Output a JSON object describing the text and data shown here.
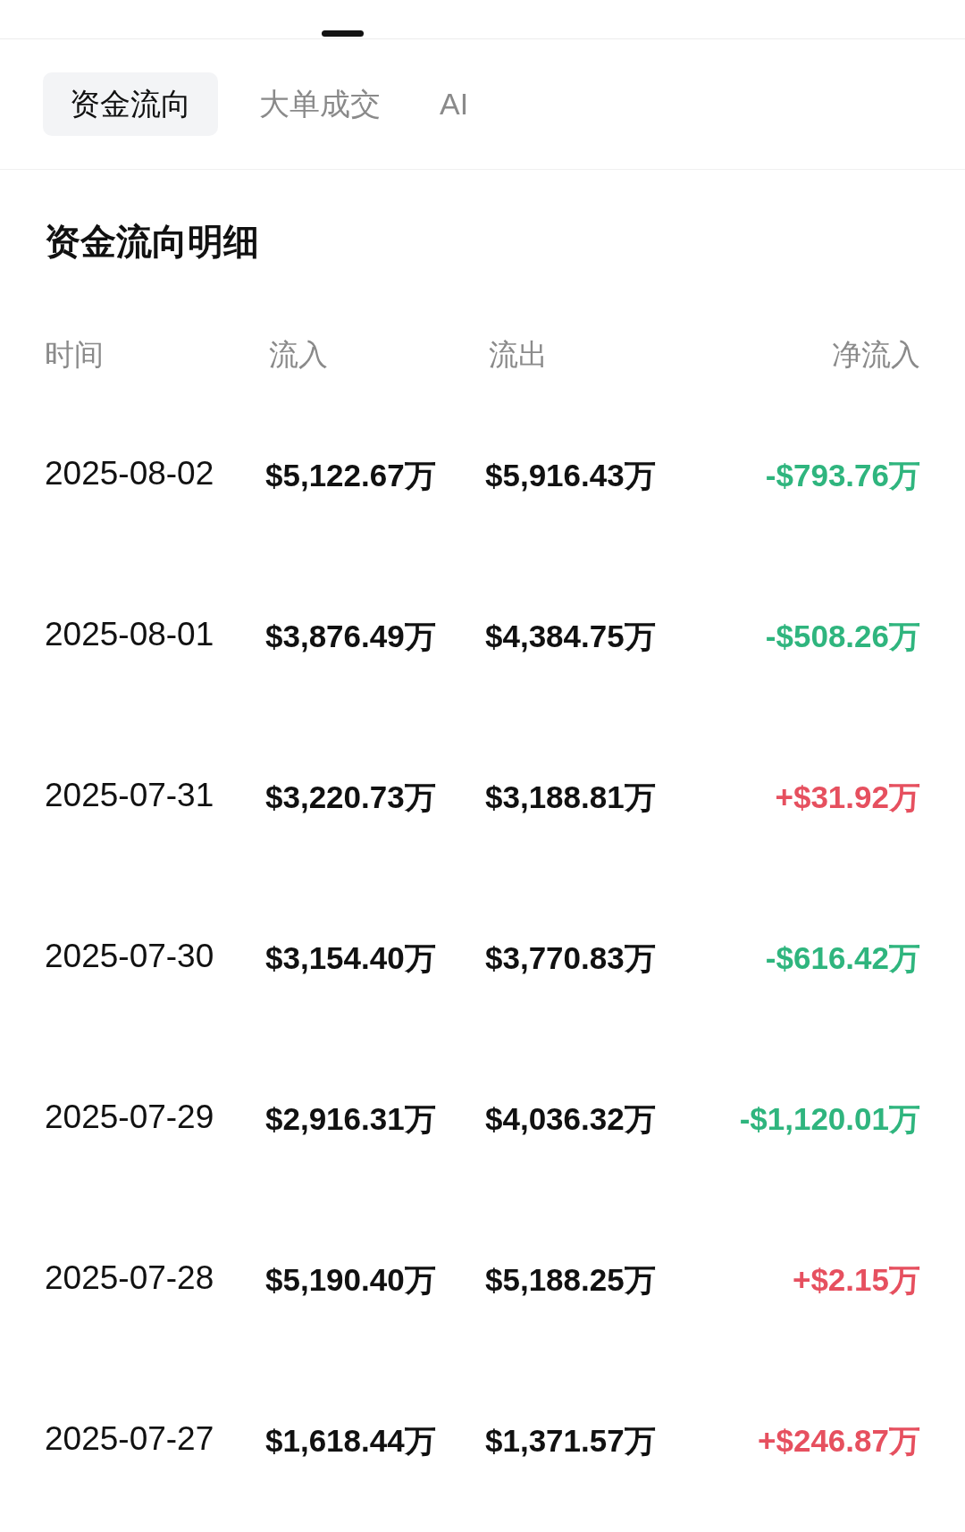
{
  "sub_tabs": [
    {
      "label": "资金流向",
      "selected": true
    },
    {
      "label": "大单成交",
      "selected": false
    },
    {
      "label": "AI",
      "selected": false
    }
  ],
  "section": {
    "title": "资金流向明细"
  },
  "table": {
    "columns": [
      "时间",
      "流入",
      "流出",
      "净流入"
    ],
    "rows": [
      {
        "date": "2025-08-02",
        "inflow": "$5,122.67万",
        "outflow": "$5,916.43万",
        "net": "-$793.76万",
        "color": "#2fb57e"
      },
      {
        "date": "2025-08-01",
        "inflow": "$3,876.49万",
        "outflow": "$4,384.75万",
        "net": "-$508.26万",
        "color": "#2fb57e"
      },
      {
        "date": "2025-07-31",
        "inflow": "$3,220.73万",
        "outflow": "$3,188.81万",
        "net": "+$31.92万",
        "color": "#e6505f"
      },
      {
        "date": "2025-07-30",
        "inflow": "$3,154.40万",
        "outflow": "$3,770.83万",
        "net": "-$616.42万",
        "color": "#2fb57e"
      },
      {
        "date": "2025-07-29",
        "inflow": "$2,916.31万",
        "outflow": "$4,036.32万",
        "net": "-$1,120.01万",
        "color": "#2fb57e"
      },
      {
        "date": "2025-07-28",
        "inflow": "$5,190.40万",
        "outflow": "$5,188.25万",
        "net": "+$2.15万",
        "color": "#e6505f"
      },
      {
        "date": "2025-07-27",
        "inflow": "$1,618.44万",
        "outflow": "$1,371.57万",
        "net": "+$246.87万",
        "color": "#e6505f"
      }
    ]
  }
}
